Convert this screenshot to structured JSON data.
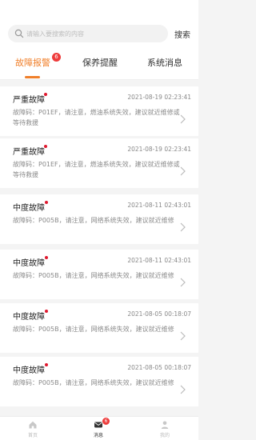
{
  "search": {
    "placeholder": "请输入要搜索的内容",
    "button": "搜索"
  },
  "tabs": [
    {
      "label": "故障报警",
      "badge": "6"
    },
    {
      "label": "保养提醒"
    },
    {
      "label": "系统消息"
    }
  ],
  "alerts": [
    {
      "title": "严重故障",
      "time": "2021-08-19 02:23:41",
      "desc": "故障码：P01EF，请注意，燃油系统失效，建议就近维修或等待救援"
    },
    {
      "title": "严重故障",
      "time": "2021-08-19 02:23:41",
      "desc": "故障码：P01EF，请注意，燃油系统失效，建议就近维修或等待救援"
    },
    {
      "title": "中度故障",
      "time": "2021-08-11 02:43:01",
      "desc": "故障码：P005B，请注意，网络系统失效，建议就近维修"
    },
    {
      "title": "中度故障",
      "time": "2021-08-11 02:43:01",
      "desc": "故障码：P005B，请注意，网络系统失效，建议就近维修"
    },
    {
      "title": "中度故障",
      "time": "2021-08-05 00:18:07",
      "desc": "故障码：P005B，请注意，网络系统失效，建议就近维修"
    },
    {
      "title": "中度故障",
      "time": "2021-08-05 00:18:07",
      "desc": "故障码：P005B，请注意，网络系统失效，建议就近维修"
    }
  ],
  "bottom_nav": [
    {
      "label": "首页",
      "icon": "home-icon"
    },
    {
      "label": "消息",
      "icon": "message-icon",
      "badge": "6"
    },
    {
      "label": "我的",
      "icon": "user-icon"
    }
  ],
  "colors": {
    "accent": "#f07f2a",
    "badge": "#ee3b3b",
    "dot": "#e0192f"
  }
}
